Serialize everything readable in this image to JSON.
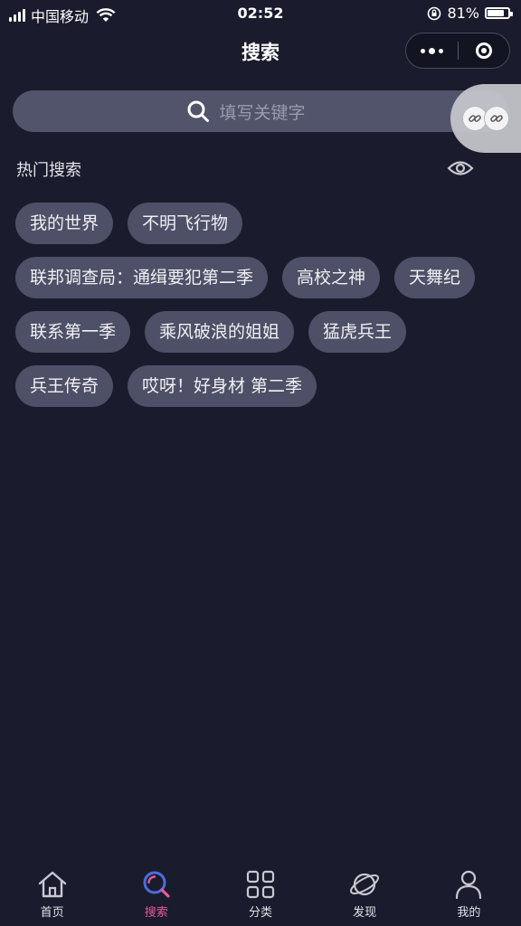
{
  "status": {
    "carrier": "中国移动",
    "time": "02:52",
    "battery": "81%",
    "battery_level": 0.81
  },
  "nav": {
    "title": "搜索"
  },
  "search": {
    "placeholder": "填写关键字"
  },
  "hot": {
    "title": "热门搜索",
    "tags": [
      "我的世界",
      "不明飞行物",
      "联邦调查局：通缉要犯第二季",
      "高校之神",
      "天舞纪",
      "联系第一季",
      "乘风破浪的姐姐",
      "猛虎兵王",
      "兵王传奇",
      "哎呀！好身材 第二季"
    ]
  },
  "tabs": [
    {
      "label": "首页",
      "icon": "home-icon"
    },
    {
      "label": "搜索",
      "icon": "search-tab-icon",
      "active": true
    },
    {
      "label": "分类",
      "icon": "category-icon"
    },
    {
      "label": "发现",
      "icon": "planet-icon"
    },
    {
      "label": "我的",
      "icon": "profile-icon"
    }
  ],
  "colors": {
    "background": "#1a1b2c",
    "tag_background": "#4d5066",
    "active_tab": "#e55a9b",
    "active_icon": "#4c6de0"
  }
}
